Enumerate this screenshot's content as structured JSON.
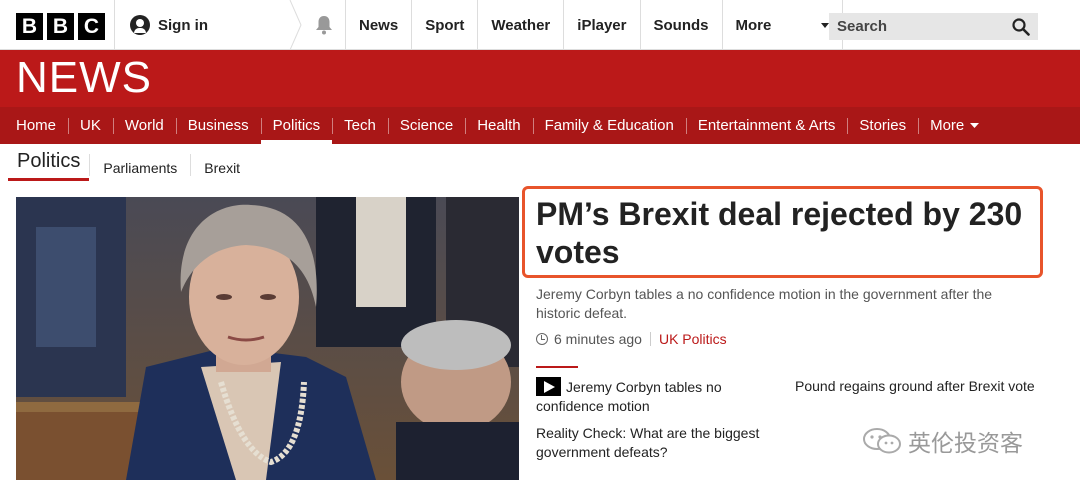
{
  "brand": {
    "logo_letters": [
      "B",
      "B",
      "C"
    ],
    "section": "NEWS"
  },
  "topbar": {
    "signin_label": "Sign in",
    "nav": [
      "News",
      "Sport",
      "Weather",
      "iPlayer",
      "Sounds"
    ],
    "more_label": "More",
    "search_placeholder": "Search"
  },
  "rednav": {
    "items": [
      "Home",
      "UK",
      "World",
      "Business",
      "Politics",
      "Tech",
      "Science",
      "Health",
      "Family & Education",
      "Entertainment & Arts",
      "Stories"
    ],
    "active": "Politics",
    "more_label": "More"
  },
  "subnav": {
    "title": "Politics",
    "items": [
      "Parliaments",
      "Brexit"
    ]
  },
  "story": {
    "headline": "PM’s Brexit deal rejected by 230 votes",
    "summary": "Jeremy Corbyn tables a no confidence motion in the government after the historic defeat.",
    "time": "6 minutes ago",
    "category": "UK Politics"
  },
  "related": [
    {
      "text": "Jeremy Corbyn tables no confidence motion",
      "video": true
    },
    {
      "text": "Pound regains ground after Brexit vote",
      "video": false
    },
    {
      "text": "Reality Check: What are the biggest government defeats?",
      "video": false
    }
  ],
  "watermark": "英伦投资客",
  "colors": {
    "brand_red": "#bb1919",
    "nav_red": "#a91717",
    "highlight": "#e8542b"
  }
}
